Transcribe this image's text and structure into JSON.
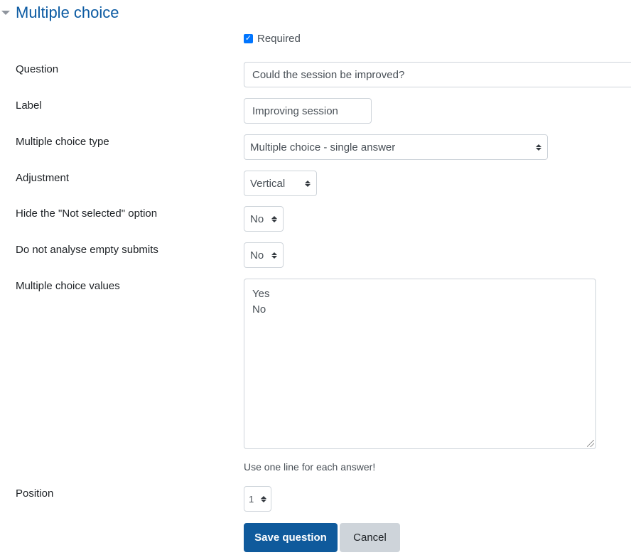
{
  "section": {
    "title": "Multiple choice",
    "collapse_icon": "caret-down-icon"
  },
  "required": {
    "label": "Required",
    "checked": true
  },
  "fields": {
    "question": {
      "label": "Question",
      "value": "Could the session be improved?"
    },
    "label": {
      "label": "Label",
      "value": "Improving session"
    },
    "type": {
      "label": "Multiple choice type",
      "value": "Multiple choice - single answer"
    },
    "adjustment": {
      "label": "Adjustment",
      "value": "Vertical"
    },
    "hide_not_selected": {
      "label": "Hide the \"Not selected\" option",
      "value": "No"
    },
    "ignore_empty": {
      "label": "Do not analyse empty submits",
      "value": "No"
    },
    "values": {
      "label": "Multiple choice values",
      "lines": [
        "Yes",
        "No"
      ],
      "help": "Use one line for each answer!"
    },
    "position": {
      "label": "Position",
      "value": "1"
    }
  },
  "buttons": {
    "save": "Save question",
    "cancel": "Cancel"
  }
}
